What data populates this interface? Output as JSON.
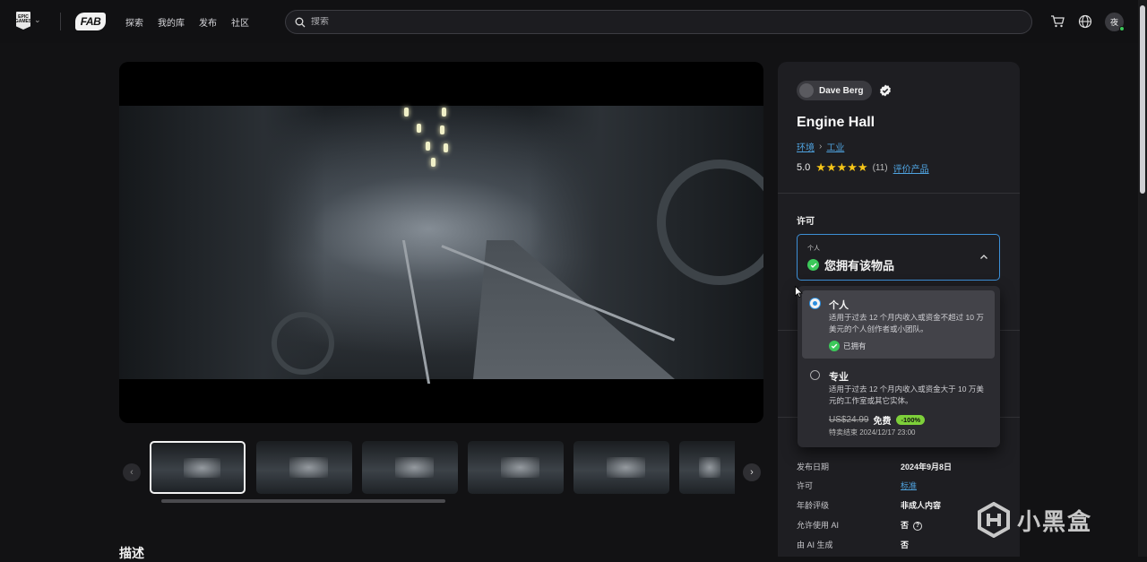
{
  "topbar": {
    "epic_logo_text": "EPIC GAMES",
    "fab_logo_text": "FAB",
    "nav": [
      "探索",
      "我的库",
      "发布",
      "社区"
    ],
    "search_placeholder": "搜索",
    "avatar_initial": "夜"
  },
  "product": {
    "author": "Dave Berg",
    "title": "Engine Hall",
    "breadcrumb": [
      "环境",
      "工业"
    ],
    "rating": "5.0",
    "stars": "★★★★★",
    "review_count": "(11)",
    "rate_link": "评价产品"
  },
  "license": {
    "label": "许可",
    "selected_small": "个人",
    "selected_status": "您拥有该物品",
    "options": [
      {
        "name": "个人",
        "desc": "适用于过去 12 个月内收入或资金不超过 10 万美元的个人创作者或小团队。",
        "owned": "已拥有"
      },
      {
        "name": "专业",
        "desc": "适用于过去 12 个月内收入或资金大于 10 万美元的工作室或其它实体。",
        "old_price": "US$24.99",
        "new_price": "免费",
        "discount": "-100%",
        "sale_end": "特卖结束 2024/12/17 23:00"
      }
    ]
  },
  "details": [
    {
      "k": "发布日期",
      "v": "2024年9月8日"
    },
    {
      "k": "许可",
      "v": "标准"
    },
    {
      "k": "年龄评级",
      "v": "非成人内容"
    },
    {
      "k": "允许使用 AI",
      "v": "否"
    },
    {
      "k": "由 AI 生成",
      "v": "否"
    }
  ],
  "gallery": {
    "prev_label": "‹",
    "next_label": "›"
  },
  "description_title": "描述",
  "watermark": "小黑盒"
}
